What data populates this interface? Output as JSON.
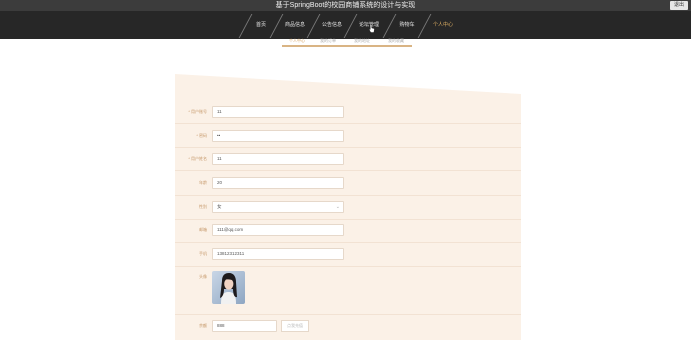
{
  "header": {
    "site_title": "基于SpringBoot的校园商铺系统的设计与实现",
    "exit_label": "退出"
  },
  "nav": {
    "items": [
      {
        "label": "首页"
      },
      {
        "label": "商品信息"
      },
      {
        "label": "公告信息"
      },
      {
        "label": "论坛管理"
      },
      {
        "label": "购物车"
      },
      {
        "label": "个人中心"
      }
    ],
    "active_index": 5
  },
  "subtabs": [
    {
      "label": "个人中心"
    },
    {
      "label": "我的订单"
    },
    {
      "label": "我的地址"
    },
    {
      "label": "我的收藏"
    }
  ],
  "form": {
    "username": {
      "label": "* 用户账号",
      "value": "11"
    },
    "password": {
      "label": "* 密码",
      "value": "••"
    },
    "fullname": {
      "label": "* 用户姓名",
      "value": "11"
    },
    "age": {
      "label": "年龄",
      "value": "20"
    },
    "gender": {
      "label": "性别",
      "value": "女"
    },
    "email": {
      "label": "邮箱",
      "value": "111@qq.com"
    },
    "phone": {
      "label": "手机",
      "value": "13812312311"
    },
    "avatar": {
      "label": "头像"
    },
    "balance": {
      "label": "余额",
      "value": "888",
      "button_label": "点我充值"
    }
  },
  "colors": {
    "topbar": "#3c3c3c",
    "navbar": "#272727",
    "accent": "#d6a463",
    "panel": "#fbf1e7"
  }
}
